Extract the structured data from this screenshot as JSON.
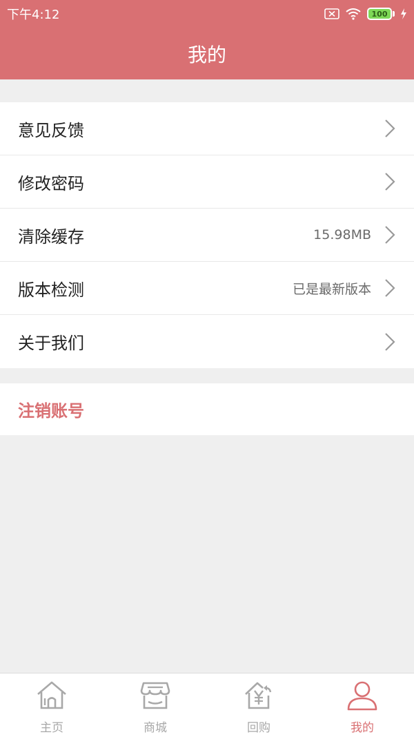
{
  "colors": {
    "accent": "#d97073",
    "tab_inactive": "#a8a8a8"
  },
  "status_bar": {
    "time": "下午4:12",
    "battery": "100",
    "icons": [
      "sim-none-icon",
      "wifi-icon",
      "battery-icon",
      "charging-icon"
    ]
  },
  "header": {
    "title": "我的"
  },
  "menu": {
    "items": [
      {
        "label": "意见反馈",
        "value": ""
      },
      {
        "label": "修改密码",
        "value": ""
      },
      {
        "label": "清除缓存",
        "value": "15.98MB"
      },
      {
        "label": "版本检测",
        "value": "已是最新版本"
      },
      {
        "label": "关于我们",
        "value": ""
      }
    ]
  },
  "logout": {
    "label": "注销账号"
  },
  "tabbar": {
    "active": 3,
    "items": [
      {
        "label": "主页",
        "icon": "home-icon"
      },
      {
        "label": "商城",
        "icon": "shop-icon"
      },
      {
        "label": "回购",
        "icon": "buyback-icon"
      },
      {
        "label": "我的",
        "icon": "user-icon"
      }
    ]
  }
}
